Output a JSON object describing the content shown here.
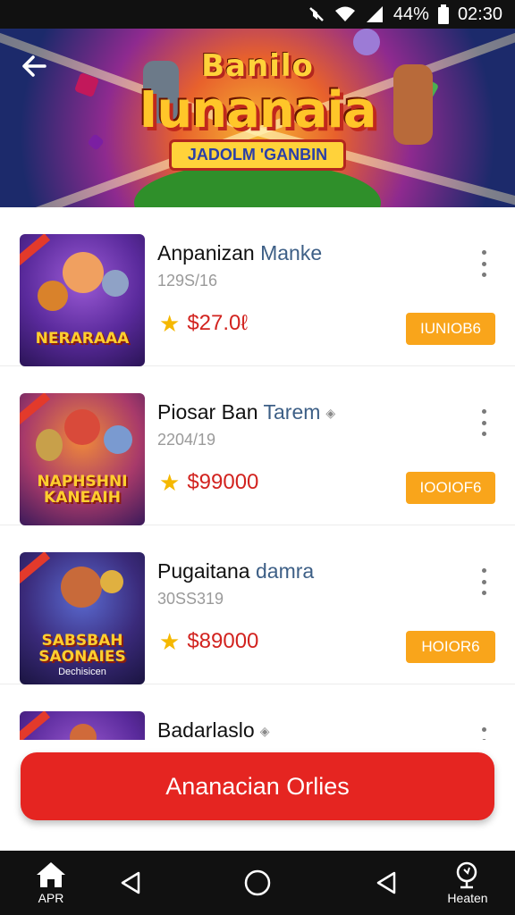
{
  "status_bar": {
    "battery_text": "44%",
    "time": "02:30",
    "icons": [
      "mute-icon",
      "wifi-icon",
      "signal-icon",
      "battery-icon"
    ]
  },
  "hero": {
    "title_top": "Banilo",
    "title_main": "Iunanaia",
    "title_sub": "JADOLM 'GANBIN"
  },
  "items": [
    {
      "thumb_text": "NERARAAA",
      "thumb_subtext": "",
      "title": "Anpanizan",
      "title_accent": "Manke",
      "subtitle": "129S/16",
      "price": "$27.0ℓ",
      "button": "IUNIOB6",
      "has_tag": false
    },
    {
      "thumb_text": "NAPHSHNI KANEAIH",
      "thumb_subtext": "",
      "title": "Piosar Ban",
      "title_accent": "Tarem",
      "subtitle": "2204/19",
      "price": "$99000",
      "button": "IOOIOF6",
      "has_tag": true
    },
    {
      "thumb_text": "SABSBAH SAONAIES",
      "thumb_subtext": "Dechisicen",
      "title": "Pugaitana",
      "title_accent": "damra",
      "subtitle": "30SS319",
      "price": "$89000",
      "button": "HOIOR6",
      "has_tag": false
    },
    {
      "thumb_text": "",
      "thumb_subtext": "",
      "title": "Badarlaslo",
      "title_accent": "",
      "subtitle": "",
      "price": "",
      "button": "",
      "has_tag": true
    }
  ],
  "cta": {
    "label": "Ananacian Orlies"
  },
  "navbar": {
    "home_label": "APR",
    "search_label": "Heaten"
  },
  "colors": {
    "accent_red": "#e52521",
    "button_orange": "#f9a51b",
    "price_red": "#d2231f",
    "star_yellow": "#f5b800"
  }
}
